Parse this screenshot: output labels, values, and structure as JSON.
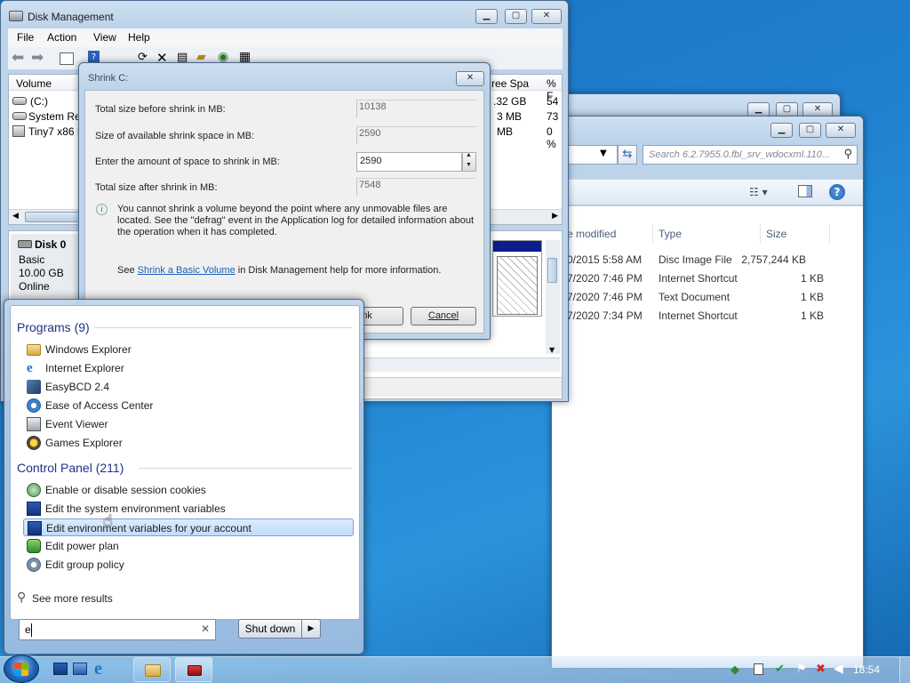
{
  "disk_mgmt": {
    "title": "Disk Management",
    "menu": [
      "File",
      "Action",
      "View",
      "Help"
    ],
    "columns": {
      "volume": "Volume",
      "free_space": "ree Spa",
      "pct": "% F"
    },
    "volumes": [
      {
        "name": "(C:)",
        "free": ".32 GB",
        "pct": "54"
      },
      {
        "name": "System Res",
        "free": "3 MB",
        "pct": "73"
      },
      {
        "name": "Tiny7 x86 R",
        "free": "MB",
        "pct": "0 %"
      }
    ],
    "disk": {
      "name": "Disk 0",
      "type": "Basic",
      "size": "10.00 GB",
      "status": "Online"
    }
  },
  "shrink": {
    "title": "Shrink C:",
    "total_before_label": "Total size before shrink in MB:",
    "total_before": "10138",
    "available_label": "Size of available shrink space in MB:",
    "available": "2590",
    "enter_label": "Enter the amount of space to shrink in MB:",
    "enter_value": "2590",
    "total_after_label": "Total size after shrink in MB:",
    "total_after": "7548",
    "info_text": "You cannot shrink a volume beyond the point where any unmovable files are located. See the \"defrag\" event in the Application log for detailed information about the operation when it has completed.",
    "see_prefix": "See ",
    "see_link": "Shrink a Basic Volume",
    "see_suffix": " in Disk Management help for more information.",
    "shrink_button": "nk",
    "cancel_button": "Cancel"
  },
  "explorer": {
    "search_placeholder": "Search 6.2.7955.0.fbl_srv_wdocxml.110...",
    "columns": {
      "modified": "e modified",
      "type": "Type",
      "size": "Size"
    },
    "files": [
      {
        "modified": "0/2015 5:58 AM",
        "type": "Disc Image File",
        "size": "2,757,244 KB"
      },
      {
        "modified": "7/2020 7:46 PM",
        "type": "Internet Shortcut",
        "size": "1 KB"
      },
      {
        "modified": "7/2020 7:46 PM",
        "type": "Text Document",
        "size": "1 KB"
      },
      {
        "modified": "7/2020 7:34 PM",
        "type": "Internet Shortcut",
        "size": "1 KB"
      }
    ]
  },
  "start_menu": {
    "programs_header": "Programs (9)",
    "programs": [
      {
        "label": "Windows Explorer",
        "icon": "folder-icon"
      },
      {
        "label": "Internet Explorer",
        "icon": "ie-icon"
      },
      {
        "label": "EasyBCD 2.4",
        "icon": "easybcd-icon"
      },
      {
        "label": "Ease of Access Center",
        "icon": "ease-of-access-icon"
      },
      {
        "label": "Event Viewer",
        "icon": "event-viewer-icon"
      },
      {
        "label": "Games Explorer",
        "icon": "games-icon"
      }
    ],
    "control_panel_header": "Control Panel (211)",
    "control_panel": [
      {
        "label": "Enable or disable session cookies",
        "icon": "cookies-icon"
      },
      {
        "label": "Edit the system environment variables",
        "icon": "system-icon"
      },
      {
        "label": "Edit environment variables for your account",
        "icon": "system-icon"
      },
      {
        "label": "Edit power plan",
        "icon": "power-icon"
      },
      {
        "label": "Edit group policy",
        "icon": "policy-icon"
      }
    ],
    "see_more": "See more results",
    "search_value": "e",
    "shutdown_label": "Shut down"
  },
  "taskbar": {
    "clock": "18:54"
  }
}
